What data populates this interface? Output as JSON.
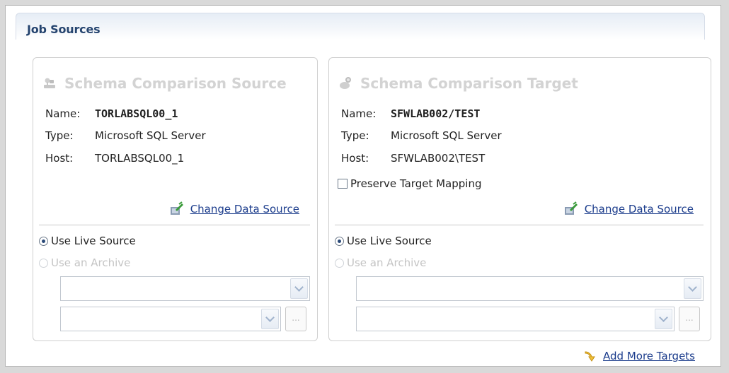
{
  "header": {
    "title": "Job Sources"
  },
  "source": {
    "title": "Schema Comparison Source",
    "name_label": "Name:",
    "name_value": "TORLABSQL00_1",
    "type_label": "Type:",
    "type_value": "Microsoft SQL Server",
    "host_label": "Host:",
    "host_value": "TORLABSQL00_1",
    "change_link": "Change Data Source",
    "use_live": "Use Live Source",
    "use_archive": "Use an Archive",
    "ellipsis": "..."
  },
  "target": {
    "title": "Schema Comparison Target",
    "name_label": "Name:",
    "name_value": "SFWLAB002/TEST",
    "type_label": "Type:",
    "type_value": "Microsoft SQL Server",
    "host_label": "Host:",
    "host_value": "SFWLAB002\\TEST",
    "preserve_label": "Preserve Target Mapping",
    "change_link": "Change Data Source",
    "use_live": "Use Live Source",
    "use_archive": "Use an Archive",
    "ellipsis": "..."
  },
  "footer": {
    "add_more": "Add More Targets"
  },
  "icons": {
    "source_title": "database-connect-icon",
    "target_title": "database-target-icon",
    "change_source": "edit-data-source-icon",
    "add_more": "add-targets-arrow-icon"
  },
  "colors": {
    "link": "#1b3c8c",
    "header_text": "#25446f",
    "disabled_text": "#c4c4c4"
  }
}
